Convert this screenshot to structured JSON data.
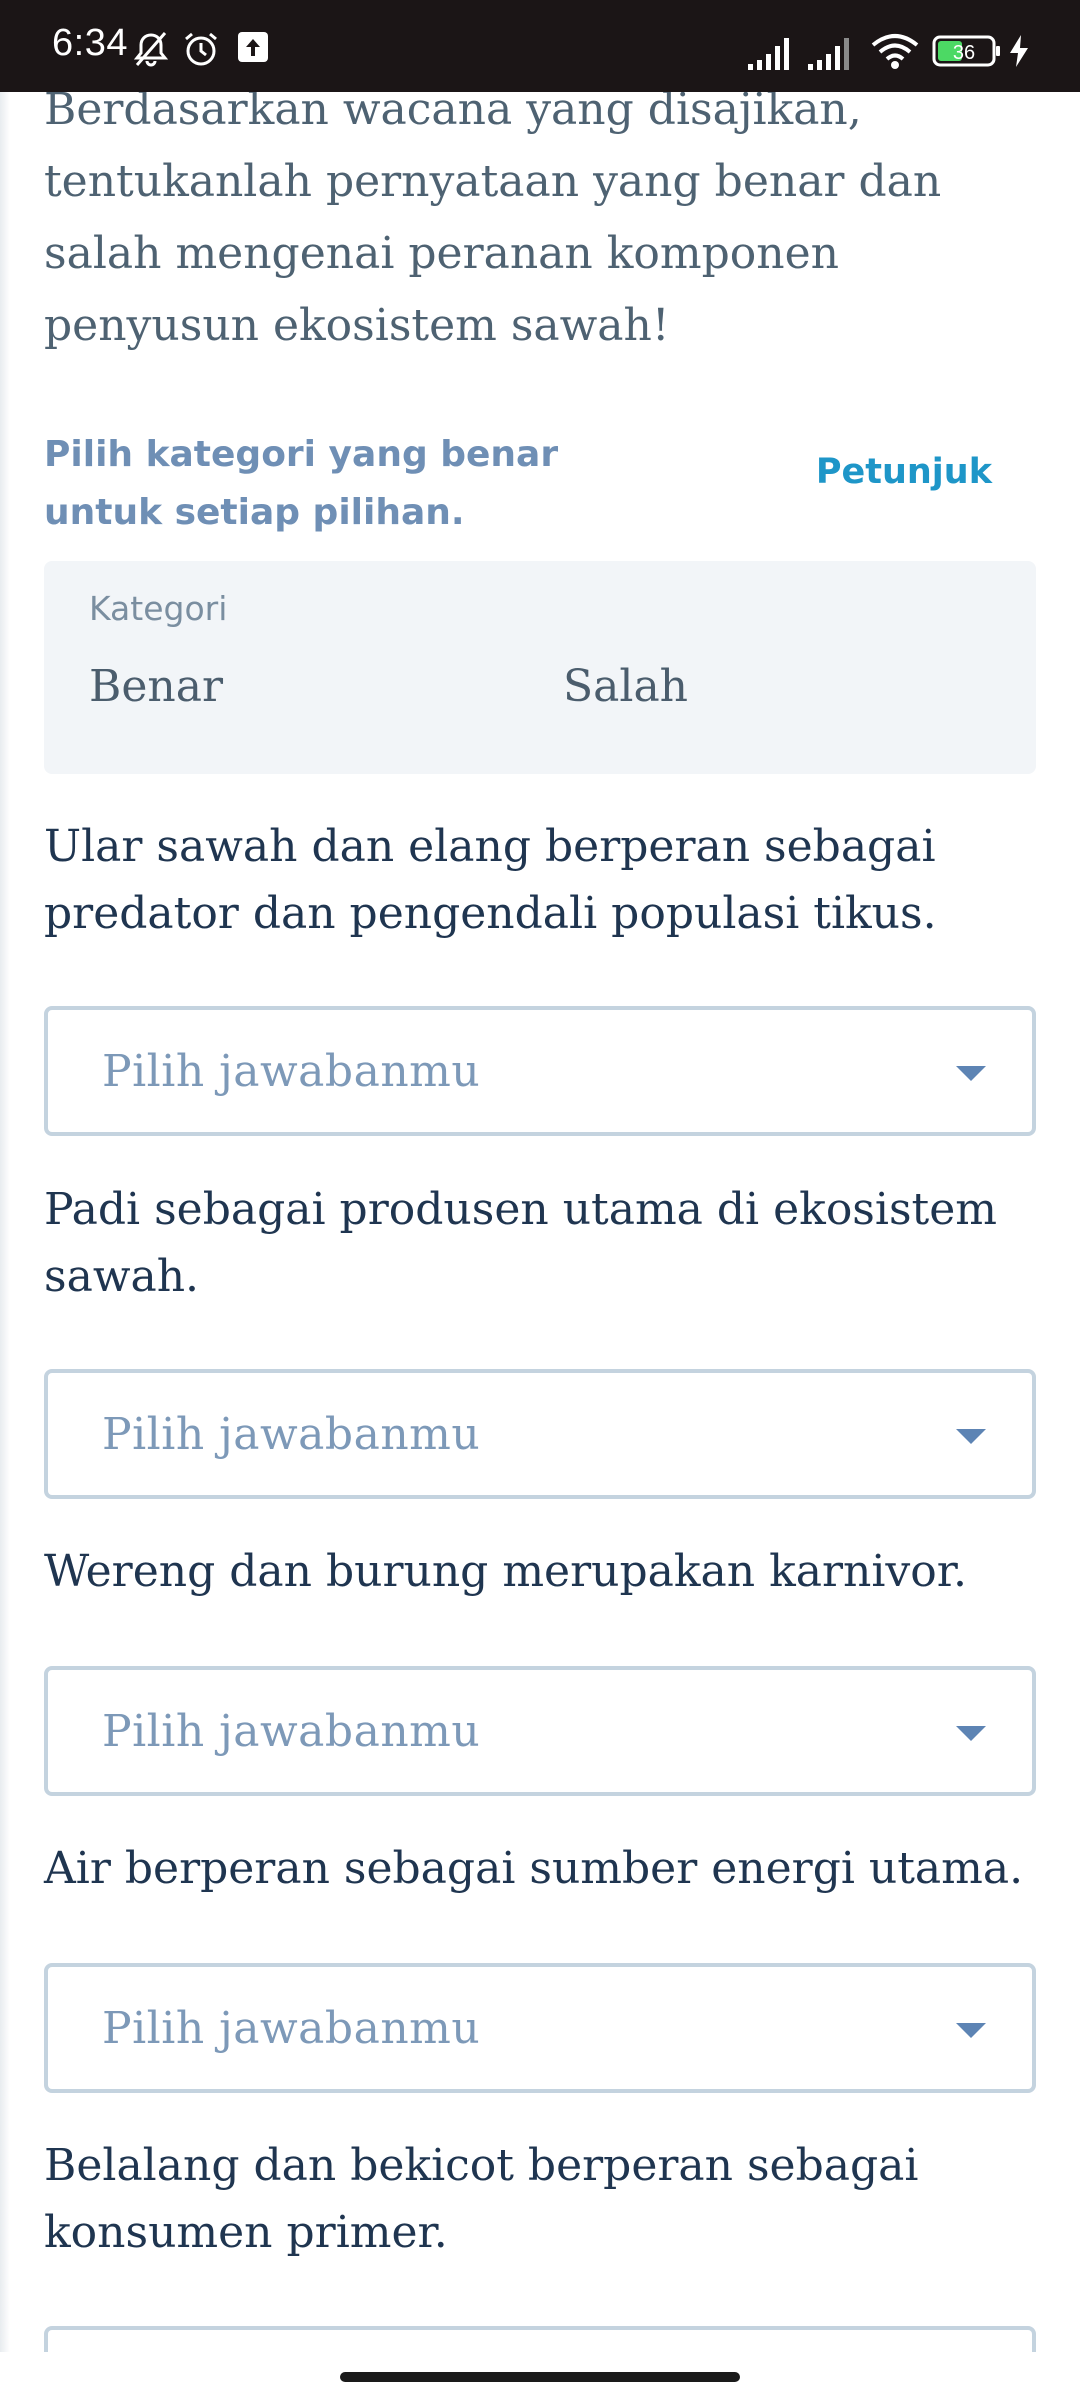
{
  "status_bar": {
    "time": "6:34",
    "battery": "36"
  },
  "intro": "Berdasarkan wacana yang disajikan, tentukanlah pernyataan yang benar dan salah mengenai peranan komponen penyusun ekosistem sawah!",
  "instruction": "Pilih kategori yang benar untuk setiap pilihan.",
  "hint_label": "Petunjuk",
  "category": {
    "heading": "Kategori",
    "options": [
      "Benar",
      "Salah"
    ]
  },
  "statements": [
    {
      "text": "Ular sawah dan elang berperan sebagai predator dan pengendali populasi tikus.",
      "placeholder": "Pilih jawabanmu"
    },
    {
      "text": "Padi sebagai produsen utama di ekosistem sawah.",
      "placeholder": "Pilih jawabanmu"
    },
    {
      "text": "Wereng dan burung merupakan karnivor.",
      "placeholder": "Pilih jawabanmu"
    },
    {
      "text": "Air berperan sebagai sumber energi utama.",
      "placeholder": "Pilih jawabanmu"
    },
    {
      "text": "Belalang dan bekicot berperan sebagai konsumen primer.",
      "placeholder": ""
    }
  ],
  "icons": {
    "status_left": [
      "notifications-off-icon",
      "alarm-icon",
      "upload-icon"
    ],
    "status_right": [
      "signal-icon",
      "signal-icon",
      "wifi-icon",
      "battery-icon",
      "charging-icon"
    ],
    "dropdown": "caret-down-icon"
  },
  "colors": {
    "status_bar_bg": "#1b1516",
    "accent_link": "#1e96c8",
    "instruction_text": "#6f8fb5",
    "dropdown_border": "#c4d3df",
    "category_bg": "#f2f5f8",
    "battery_fill": "#4cd964"
  }
}
